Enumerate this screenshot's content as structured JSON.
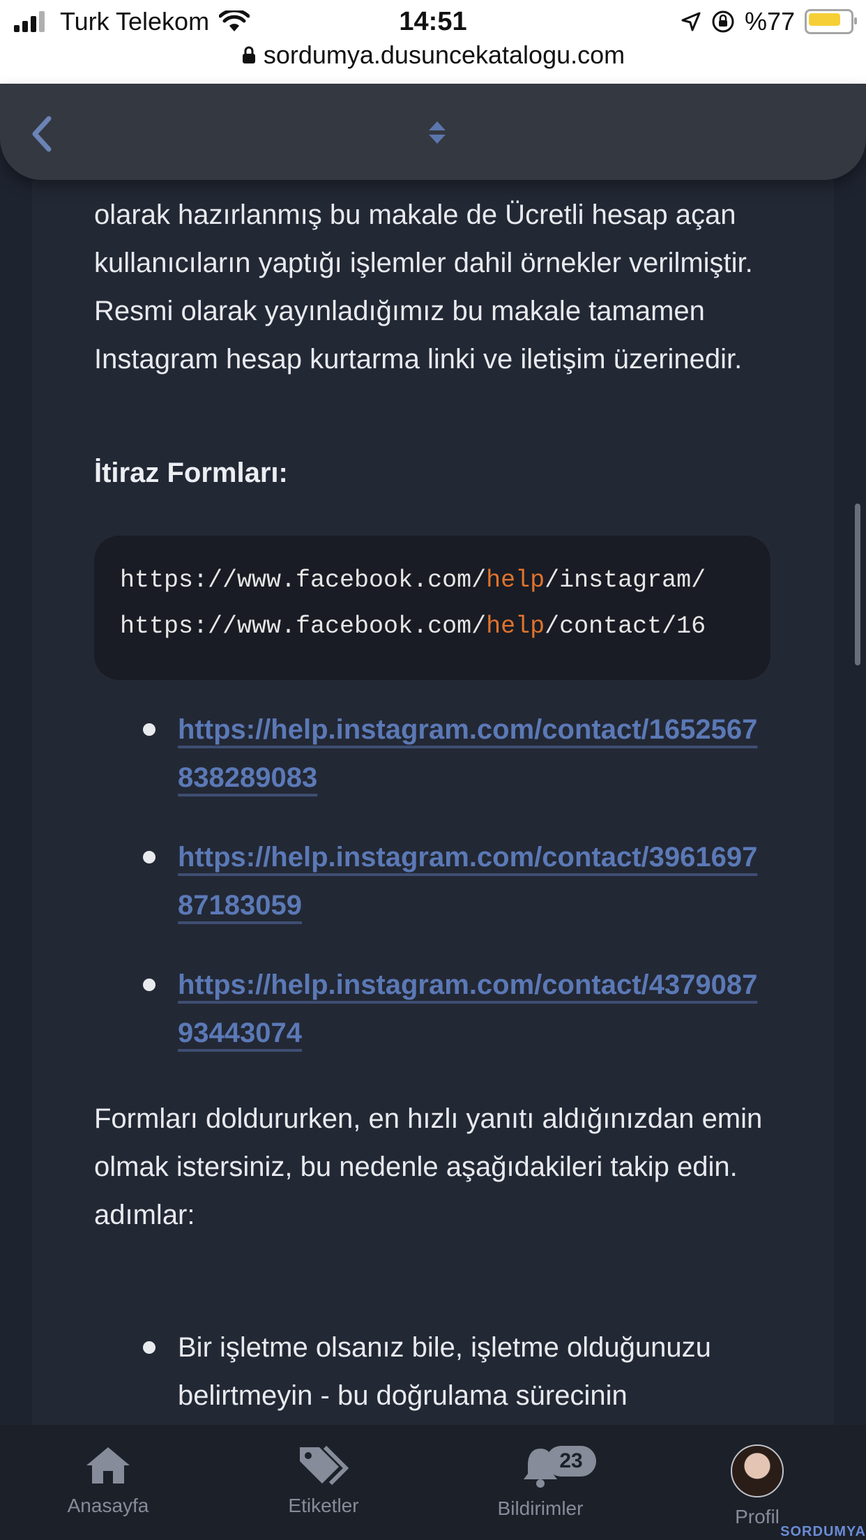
{
  "status_bar": {
    "carrier": "Turk Telekom",
    "time": "14:51",
    "battery_text": "%77",
    "battery_level": 0.77,
    "url": "sordumya.dusuncekatalogu.com"
  },
  "appbar": {
    "back_icon": "chevron-left-icon",
    "sort_icon": "sort-updown-icon"
  },
  "article": {
    "intro_text": "olarak hazırlanmış bu makale de Ücretli hesap açan kullanıcıların yaptığı işlemler dahil örnekler verilmiştir. Resmi olarak yayınladığımız bu makale tamamen Instagram hesap kurtarma linki ve iletişim üzerinedir.",
    "heading": "İtiraz Formları:",
    "code": [
      {
        "prefix": "https://www.facebook.com/",
        "keyword": "help",
        "suffix": "/instagram/"
      },
      {
        "prefix": "https://www.facebook.com/",
        "keyword": "help",
        "suffix": "/contact/16"
      }
    ],
    "links": [
      "https://help.instagram.com/contact/1652567838289083",
      "https://help.instagram.com/contact/396169787183059",
      "https://help.instagram.com/contact/437908793443074"
    ],
    "para2_line1": "Formları doldururken, en hızlı yanıtı aldığınızdan emin olmak istersiniz, bu nedenle aşağıdakileri takip edin.",
    "para2_line2": "adımlar:",
    "steps": [
      "Bir işletme olsanız bile, işletme olduğunuzu belirtmeyin - bu doğrulama sürecinin"
    ]
  },
  "bottom_nav": {
    "items": [
      {
        "label": "Anasayfa",
        "icon": "home-icon"
      },
      {
        "label": "Etiketler",
        "icon": "tags-icon"
      },
      {
        "label": "Bildirimler",
        "icon": "bell-icon",
        "badge": "23"
      },
      {
        "label": "Profil",
        "icon": "avatar"
      }
    ]
  },
  "watermark": "SORDUMYA"
}
